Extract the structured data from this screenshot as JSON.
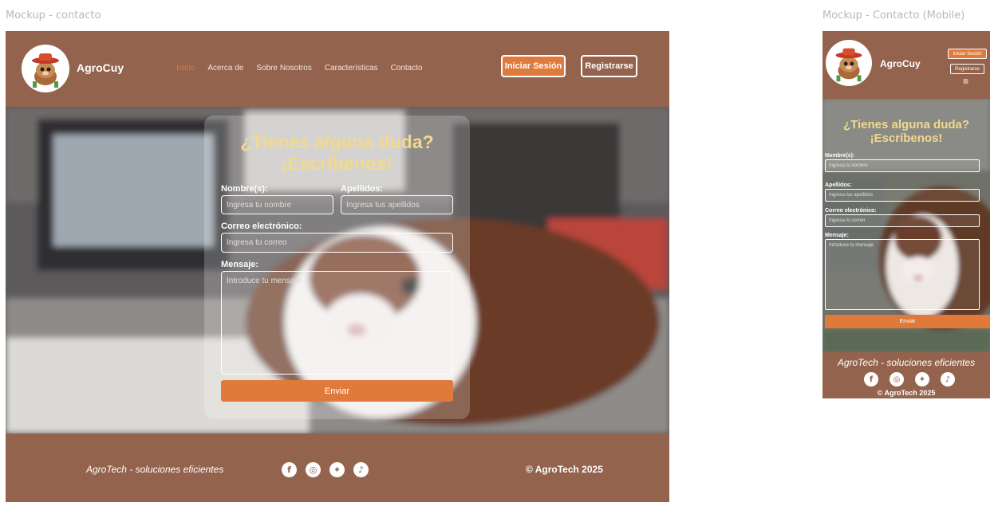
{
  "labels": {
    "desktop": "Mockup - contacto",
    "mobile": "Mockup - Contacto (Mobile)"
  },
  "brand": "AgroCuy",
  "nav": [
    "Inicio",
    "Acerca de",
    "Sobre Nosotros",
    "Características",
    "Contacto"
  ],
  "buttons": {
    "login": "Iniciar Sesión",
    "register": "Registrarse"
  },
  "form": {
    "title_line1": "¿Tienes alguna duda?",
    "title_line2": "¡Escríbenos!",
    "nombre_label": "Nombre(s):",
    "nombre_placeholder": "Ingresa tu nombre",
    "apellidos_label": "Apellidos:",
    "apellidos_placeholder": "Ingresa tus apellidos",
    "correo_label": "Correo electrónico:",
    "correo_placeholder": "Ingresa tu correo",
    "mensaje_label": "Mensaje:",
    "mensaje_placeholder": "Introduce tu mensaje",
    "send": "Enviar"
  },
  "footer": {
    "tagline": "AgroTech - soluciones eficientes",
    "copyright": "© AgroTech 2025",
    "social": [
      "facebook-icon",
      "instagram-icon",
      "twitter-icon",
      "tiktok-icon"
    ]
  },
  "colors": {
    "brown": "#94634d",
    "orange": "#e07a3b",
    "title_yellow": "#f3d98c"
  }
}
